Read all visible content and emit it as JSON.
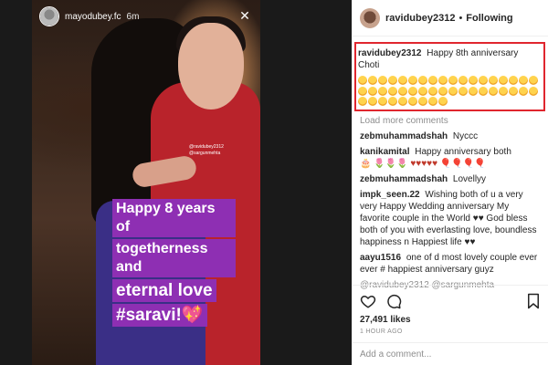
{
  "story": {
    "username": "mayodubey.fc",
    "time": "6m",
    "tag_lines": [
      "@ravidubey2312",
      "@sargunmehta"
    ],
    "caption": [
      "Happy 8 years of",
      "togetherness and",
      "eternal love",
      "#saravi!"
    ],
    "close_icon": "close-icon"
  },
  "post": {
    "username": "ravidubey2312",
    "dot": "•",
    "follow_label": "Following",
    "caption_user": "ravidubey2312",
    "caption_text": "Happy 8th anniversary Choti",
    "caption_emoji_count": 45,
    "load_more": "Load more comments",
    "comments": [
      {
        "user": "zebmuhammadshah",
        "text": "Nyccc"
      },
      {
        "user": "kanikamital",
        "text": "Happy anniversary both",
        "extra": "🎂 🌷🌷🌷 ♥♥♥♥♥ 🎈🎈🎈🎈"
      },
      {
        "user": "zebmuhammadshah",
        "text": "Lovellyy"
      },
      {
        "user": "impk_seen.22",
        "text": "Wishing both of u a very very Happy Wedding anniversary My favorite couple in the World ♥♥ God bless both of you with everlasting love, boundless happiness n Happiest life ♥♥"
      },
      {
        "user": "aayu1516",
        "text": "one of d most lovely couple ever ever # happiest anniversary guyz"
      },
      {
        "user": "",
        "text": "@ravidubey2312 @sargunmehta"
      }
    ],
    "likes": "27,491 likes",
    "time_ago": "1 HOUR AGO",
    "add_comment_placeholder": "Add a comment...",
    "icons": [
      "heart-icon",
      "comment-icon",
      "save-icon"
    ]
  },
  "colors": {
    "highlight": "#e0262e",
    "caption_bg": "#8e2fb3",
    "muted": "#8e8e8e"
  }
}
